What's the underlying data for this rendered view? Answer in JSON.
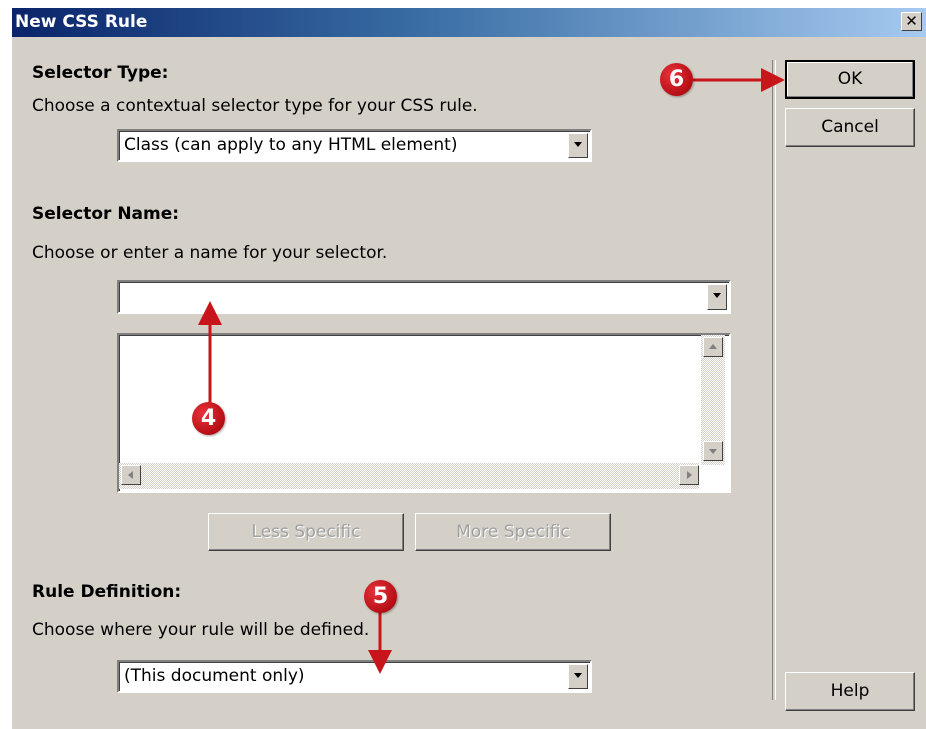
{
  "dialog": {
    "title": "New CSS Rule"
  },
  "selector_type": {
    "heading": "Selector Type:",
    "description": "Choose a contextual selector type for your CSS rule.",
    "selected": "Class (can apply to any HTML element)"
  },
  "selector_name": {
    "heading": "Selector Name:",
    "description": "Choose or enter a name for your selector.",
    "value": "",
    "less_specific_label": "Less Specific",
    "more_specific_label": "More Specific"
  },
  "rule_definition": {
    "heading": "Rule Definition:",
    "description": "Choose where your rule will be defined.",
    "selected": "(This document only)"
  },
  "buttons": {
    "ok": "OK",
    "cancel": "Cancel",
    "help": "Help"
  },
  "callouts": [
    "4",
    "5",
    "6"
  ],
  "colors": {
    "callout_red": "#c8151c",
    "title_bar": "#0a246a"
  }
}
